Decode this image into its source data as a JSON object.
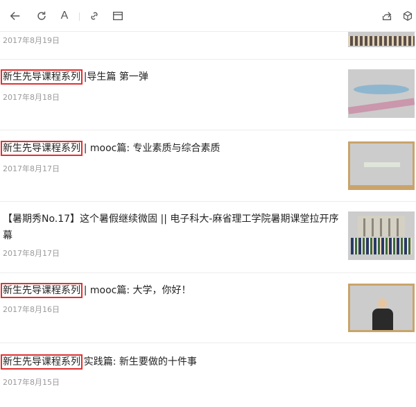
{
  "toolbar": {
    "back_icon": "arrow-left-icon",
    "refresh_icon": "refresh-icon",
    "font_label": "A",
    "link_icon": "link-icon",
    "reader_icon": "reader-mode-icon",
    "share_icon": "share-icon",
    "box_icon": "cube-icon"
  },
  "articles": [
    {
      "title_highlight": "",
      "title": "",
      "date": "2017年8月19日",
      "thumb": "auditorium"
    },
    {
      "title_highlight": "新生先导课程系列",
      "title": "||导生篇 第一弹",
      "date": "2017年8月18日",
      "thumb": "campus"
    },
    {
      "title_highlight": "新生先导课程系列",
      "title": "|| mooc篇: 专业素质与综合素质",
      "date": "2017年8月17日",
      "thumb": "chalkboard"
    },
    {
      "title_highlight": "",
      "title": "【暑期秀No.17】这个暑假继续微固 || 电子科大-麻省理工学院暑期课堂拉开序幕",
      "date": "2017年8月17日",
      "thumb": "group-photo"
    },
    {
      "title_highlight": "新生先导课程系列",
      "title": "|| mooc篇: 大学，你好！",
      "date": "2017年8月16日",
      "thumb": "teacher"
    },
    {
      "title_highlight": "新生先导课程系列",
      "title": "|实践篇: 新生要做的十件事",
      "date": "2017年8月15日",
      "thumb": ""
    }
  ],
  "colors": {
    "highlight_border": "#e03030",
    "date": "#999999",
    "divider": "#ececec"
  }
}
